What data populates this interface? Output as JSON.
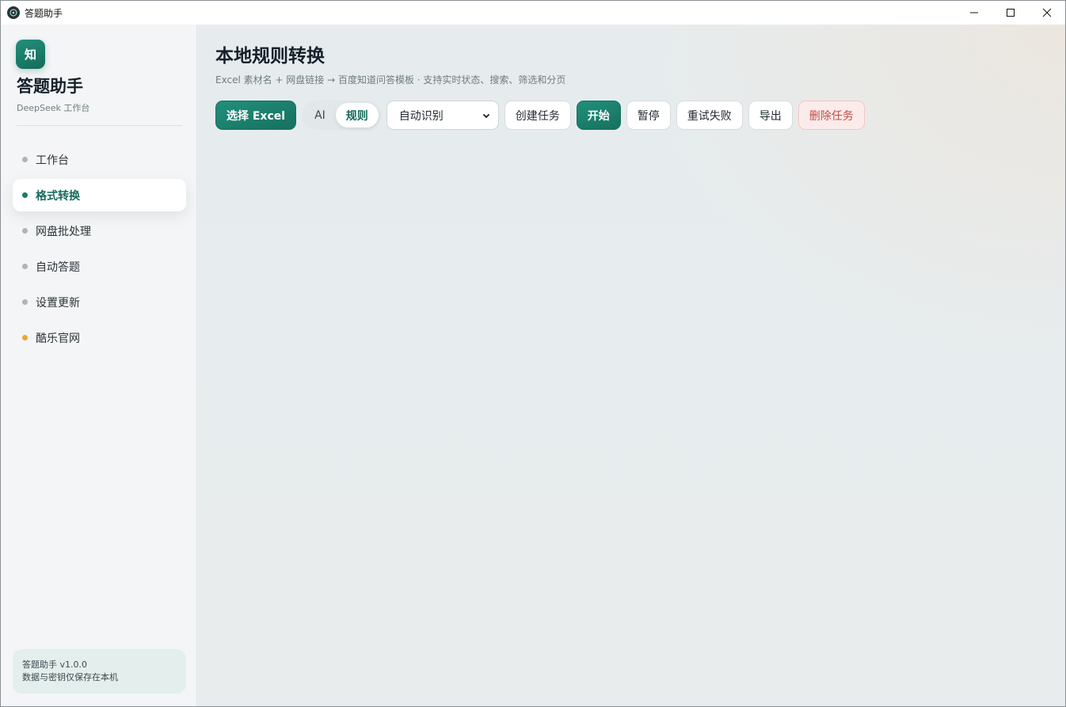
{
  "window": {
    "title": "答题助手"
  },
  "sidebar": {
    "logo_text": "知",
    "brand_name": "答题助手",
    "brand_sub": "DeepSeek 工作台",
    "items": [
      {
        "label": "工作台"
      },
      {
        "label": "格式转换",
        "active": true
      },
      {
        "label": "网盘批处理"
      },
      {
        "label": "自动答题"
      },
      {
        "label": "设置更新"
      },
      {
        "label": "酷乐官网"
      }
    ],
    "footer_line1": "答题助手 v1.0.0",
    "footer_line2": "数据与密钥仅保存在本机"
  },
  "main": {
    "title": "本地规则转换",
    "subtitle": "Excel 素材名 + 网盘链接 → 百度知道问答模板 · 支持实时状态、搜索、筛选和分页",
    "toolbar": {
      "select_excel": "选择 Excel",
      "mode_ai": "AI",
      "mode_rule": "规则",
      "mode_selected": "规则",
      "format_select_value": "自动识别",
      "create_task": "创建任务",
      "start": "开始",
      "pause": "暂停",
      "retry_failed": "重试失败",
      "export": "导出",
      "delete_task": "删除任务"
    }
  },
  "colors": {
    "accent": "#16705f",
    "danger": "#c24a40",
    "link_dot": "#f0a531"
  }
}
